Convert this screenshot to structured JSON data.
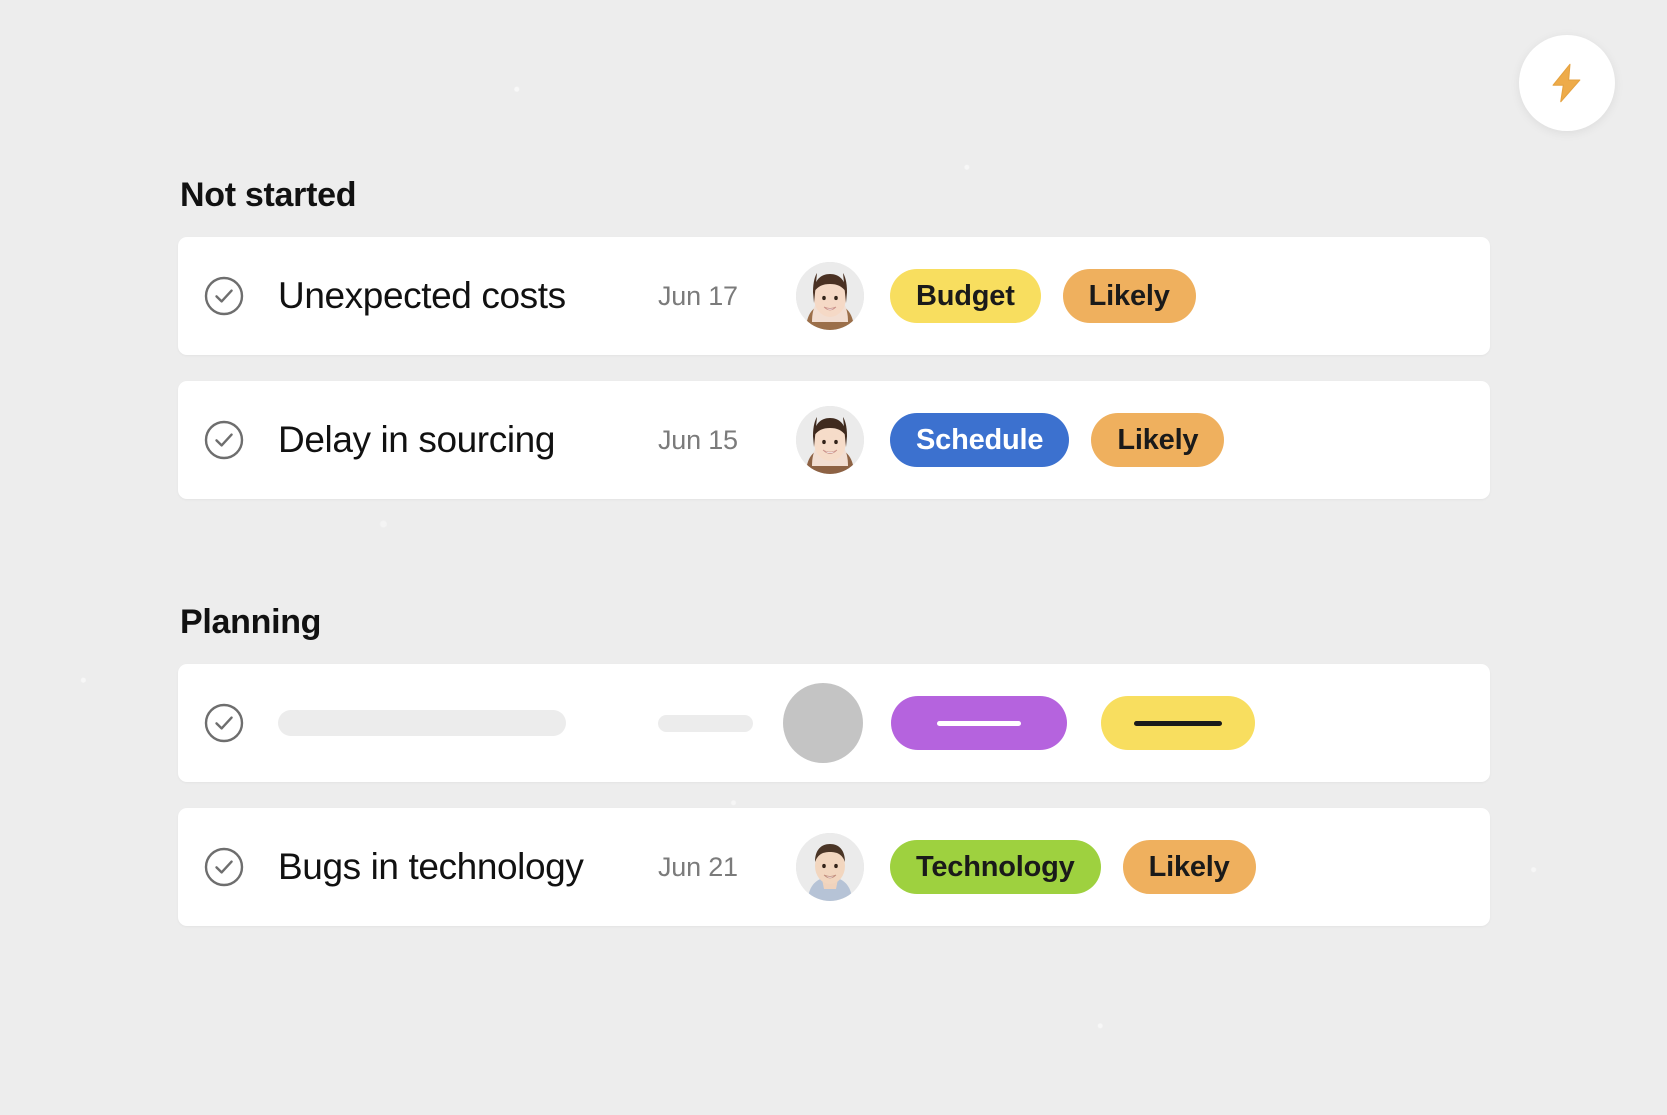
{
  "background_color": "#ededed",
  "fab": {
    "icon": "lightning-bolt-icon",
    "color": "#eeab49",
    "background": "#ffffff"
  },
  "groups": [
    {
      "title": "Not started",
      "rows": [
        {
          "type": "task",
          "checkbox_icon": "circle-check-icon",
          "title": "Unexpected costs",
          "date": "Jun 17",
          "avatar": "avatar-woman-1",
          "tags": [
            {
              "label": "Budget",
              "bg": "#f8de5f",
              "fg": "#1a1a1a"
            },
            {
              "label": "Likely",
              "bg": "#efb05e",
              "fg": "#1a1a1a"
            }
          ]
        },
        {
          "type": "task",
          "checkbox_icon": "circle-check-icon",
          "title": "Delay in sourcing",
          "date": "Jun 15",
          "avatar": "avatar-woman-2",
          "tags": [
            {
              "label": "Schedule",
              "bg": "#3c71cf",
              "fg": "#ffffff"
            },
            {
              "label": "Likely",
              "bg": "#efb05e",
              "fg": "#1a1a1a"
            }
          ]
        }
      ]
    },
    {
      "title": "Planning",
      "rows": [
        {
          "type": "skeleton",
          "checkbox_icon": "circle-check-icon",
          "title": "",
          "date": "",
          "avatar": "",
          "placeholder_color": "#ececec",
          "avatar_color": "#c4c4c4",
          "tags": [
            {
              "label": "",
              "bg": "#b563de",
              "fg": "#ffffff",
              "bar": "#ffffff"
            },
            {
              "label": "",
              "bg": "#f8de5f",
              "fg": "#1a1a1a",
              "bar": "#1a1a1a"
            }
          ]
        },
        {
          "type": "task",
          "checkbox_icon": "circle-check-icon",
          "title": "Bugs in technology",
          "date": "Jun 21",
          "avatar": "avatar-man-1",
          "tags": [
            {
              "label": "Technology",
              "bg": "#9ed13f",
              "fg": "#1a1a1a"
            },
            {
              "label": "Likely",
              "bg": "#efb05e",
              "fg": "#1a1a1a"
            }
          ]
        }
      ]
    }
  ]
}
